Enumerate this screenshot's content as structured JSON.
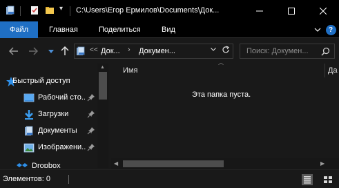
{
  "window": {
    "title": "C:\\Users\\Егор Ермилов\\Documents\\Док..."
  },
  "ribbon": {
    "tabs": [
      {
        "label": "Файл",
        "active": true
      },
      {
        "label": "Главная",
        "active": false
      },
      {
        "label": "Поделиться",
        "active": false
      },
      {
        "label": "Вид",
        "active": false
      }
    ],
    "help_label": "?"
  },
  "address": {
    "overflow": "<<",
    "segments": [
      "Док...",
      "Докумен..."
    ]
  },
  "search": {
    "placeholder": "Поиск: Докумен..."
  },
  "nav_pane": {
    "items": [
      {
        "label": "Быстрый доступ",
        "icon": "star-icon",
        "pinned": false
      },
      {
        "label": "Рабочий сто...",
        "icon": "desktop-icon",
        "pinned": true
      },
      {
        "label": "Загрузки",
        "icon": "download-icon",
        "pinned": true
      },
      {
        "label": "Документы",
        "icon": "documents-icon",
        "pinned": true
      },
      {
        "label": "Изображени...",
        "icon": "pictures-icon",
        "pinned": true
      },
      {
        "label": "Dropbox",
        "icon": "dropbox-icon",
        "pinned": false
      }
    ]
  },
  "content": {
    "columns": [
      "Имя",
      "Да"
    ],
    "empty_message": "Эта папка пуста."
  },
  "status": {
    "text": "Элементов: 0"
  },
  "colors": {
    "accent": "#1f6fc4",
    "background": "#191919",
    "titlebar": "#000000"
  }
}
